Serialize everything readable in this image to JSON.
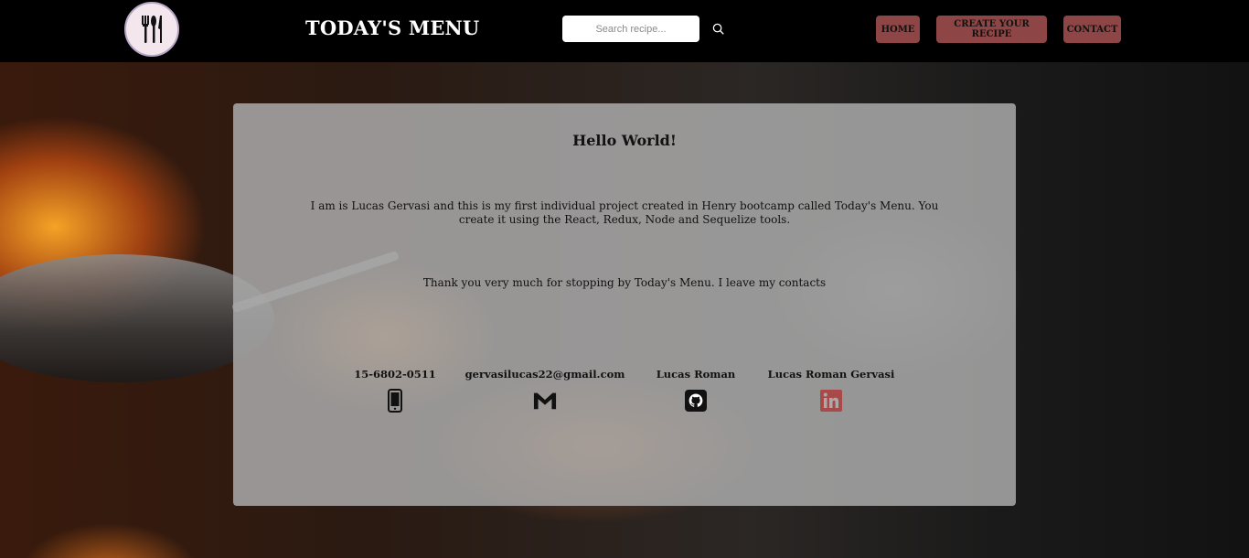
{
  "header": {
    "brand": "TODAY'S MENU",
    "search": {
      "placeholder": "Search recipe...",
      "value": ""
    },
    "search_icon": "search-icon",
    "nav": [
      {
        "label": "HOME"
      },
      {
        "label": "CREATE YOUR RECIPE"
      },
      {
        "label": "CONTACT"
      }
    ],
    "accent_color": "#8e4545"
  },
  "card": {
    "title": "Hello World!",
    "paragraph1": "I am is Lucas Gervasi and this is my first individual project created in Henry bootcamp called Today's Menu. You create it using the React, Redux, Node and Sequelize tools.",
    "paragraph2": "Thank you very much for stopping by Today's Menu. I leave my contacts",
    "contacts": [
      {
        "label": "15-6802-0511",
        "icon": "phone-icon"
      },
      {
        "label": "gervasilucas22@gmail.com",
        "icon": "gmail-icon"
      },
      {
        "label": "Lucas Roman",
        "icon": "github-icon"
      },
      {
        "label": "Lucas Roman Gervasi",
        "icon": "linkedin-icon",
        "color": "#a84a4a"
      }
    ]
  }
}
